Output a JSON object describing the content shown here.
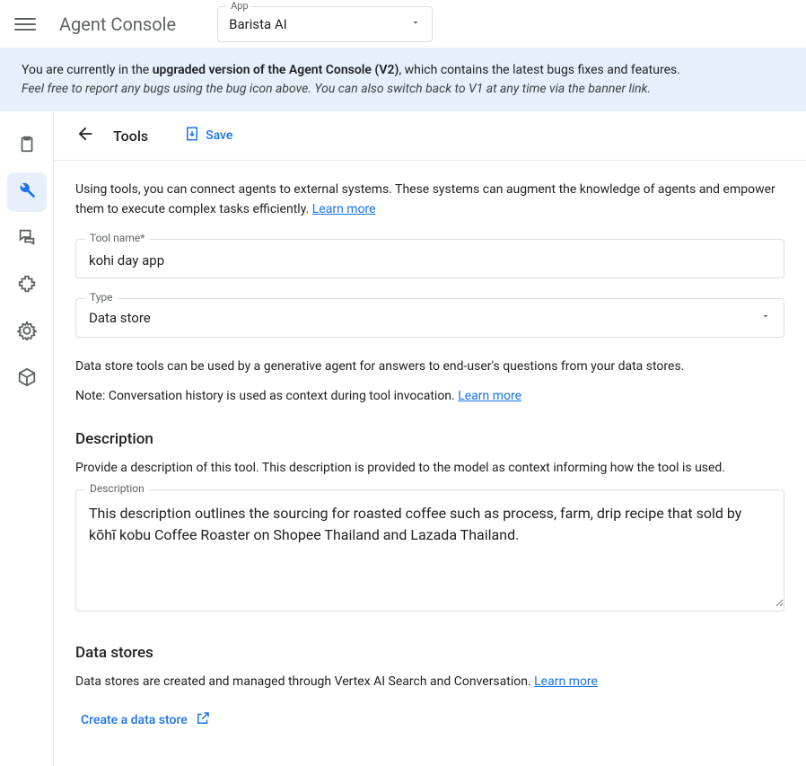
{
  "header": {
    "product_name": "Agent Console",
    "app_selector": {
      "label": "App",
      "value": "Barista AI"
    }
  },
  "banner": {
    "line1_pre": "You are currently in the ",
    "line1_bold": "upgraded version of the Agent Console (V2)",
    "line1_post": ", which contains the latest bugs fixes and features.",
    "line2": "Feel free to report any bugs using the bug icon above. You can also switch back to V1 at any time via the banner link."
  },
  "siderail": {
    "items": [
      {
        "name": "clipboard",
        "active": false
      },
      {
        "name": "build-tools",
        "active": true
      },
      {
        "name": "chat",
        "active": false
      },
      {
        "name": "extension",
        "active": false
      },
      {
        "name": "settings",
        "active": false
      },
      {
        "name": "package",
        "active": false
      }
    ]
  },
  "page": {
    "title": "Tools",
    "save_label": "Save",
    "intro_text": "Using tools, you can connect agents to external systems. These systems can augment the knowledge of agents and empower them to execute complex tasks efficiently. ",
    "learn_more": "Learn more"
  },
  "form": {
    "tool_name": {
      "label": "Tool name*",
      "value": "kohi day app"
    },
    "type": {
      "label": "Type",
      "value": "Data store"
    },
    "type_help": "Data store tools can be used by a generative agent for answers to end-user's questions from your data stores.",
    "type_note_pre": "Note: Conversation history is used as context during tool invocation. ",
    "type_note_link": "Learn more",
    "description": {
      "heading": "Description",
      "sub": "Provide a description of this tool. This description is provided to the model as context informing how the tool is used.",
      "label": "Description",
      "value": "This description outlines the sourcing for roasted coffee such as process, farm, drip recipe that sold by kōhī kobu Coffee Roaster on Shopee Thailand and Lazada Thailand."
    },
    "datastores": {
      "heading": "Data stores",
      "sub_pre": "Data stores are created and managed through Vertex AI Search and Conversation. ",
      "sub_link": "Learn more",
      "create_label": "Create a data store"
    }
  }
}
